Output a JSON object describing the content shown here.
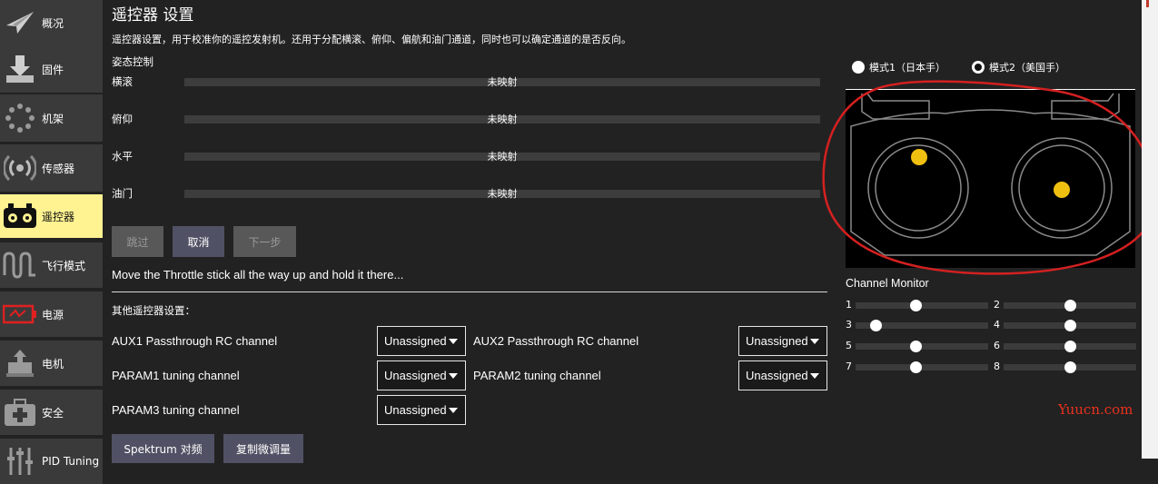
{
  "sidebar": {
    "items": [
      {
        "label": "概况",
        "icon": "paper-plane-icon"
      },
      {
        "label": "固件",
        "icon": "download-icon"
      },
      {
        "label": "机架",
        "icon": "airframe-icon"
      },
      {
        "label": "传感器",
        "icon": "radio-waves-icon"
      },
      {
        "label": "遥控器",
        "icon": "rc-transmitter-icon",
        "active": true
      },
      {
        "label": "飞行模式",
        "icon": "wave-icon"
      },
      {
        "label": "电源",
        "icon": "battery-icon"
      },
      {
        "label": "电机",
        "icon": "motor-icon"
      },
      {
        "label": "安全",
        "icon": "first-aid-icon"
      },
      {
        "label": "PID Tuning",
        "icon": "sliders-icon"
      }
    ]
  },
  "main": {
    "title": "遥控器 设置",
    "description": "遥控器设置，用于校准你的遥控发射机。还用于分配横滚、俯仰、偏航和油门通道，同时也可以确定通道的是否反向。",
    "attitude_section": "姿态控制",
    "attitude_rows": [
      {
        "name": "横滚",
        "value": "未映射"
      },
      {
        "name": "俯仰",
        "value": "未映射"
      },
      {
        "name": "水平",
        "value": "未映射"
      },
      {
        "name": "油门",
        "value": "未映射"
      }
    ],
    "buttons": {
      "skip": "跳过",
      "cancel": "取消",
      "next": "下一步"
    },
    "instruction": "Move the Throttle stick all the way up and hold it there...",
    "other_section": "其他遥控器设置：",
    "options": [
      {
        "label": "AUX1 Passthrough RC channel",
        "value": "Unassigned"
      },
      {
        "label": "AUX2 Passthrough RC channel",
        "value": "Unassigned"
      },
      {
        "label": "PARAM1 tuning channel",
        "value": "Unassigned"
      },
      {
        "label": "PARAM2 tuning channel",
        "value": "Unassigned"
      },
      {
        "label": "PARAM3 tuning channel",
        "value": "Unassigned"
      }
    ],
    "bottom_buttons": {
      "spektrum": "Spektrum 对频",
      "copy_trims": "复制微调量"
    }
  },
  "right_panel": {
    "mode1_label": "模式1（日本手）",
    "mode2_label": "模式2（美国手）",
    "selected_mode": 2,
    "channel_monitor_title": "Channel Monitor",
    "channels": [
      {
        "num": "1",
        "level": 0.45
      },
      {
        "num": "2",
        "level": 0.5
      },
      {
        "num": "3",
        "level": 0.15
      },
      {
        "num": "4",
        "level": 0.5
      },
      {
        "num": "5",
        "level": 0.45
      },
      {
        "num": "6",
        "level": 0.5
      },
      {
        "num": "7",
        "level": 0.45
      },
      {
        "num": "8",
        "level": 0.5
      }
    ],
    "stick_color": "#f0c010"
  },
  "watermark": "Yuucn.com"
}
